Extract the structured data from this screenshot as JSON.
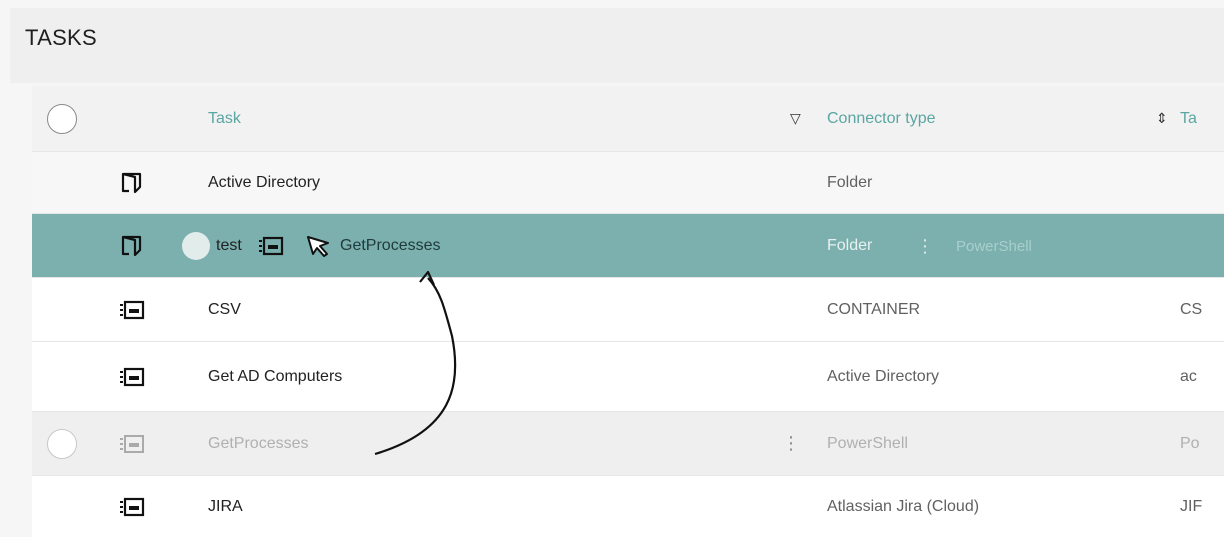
{
  "page": {
    "title": "TASKS"
  },
  "table": {
    "columns": {
      "task": "Task",
      "connector_type": "Connector type",
      "target": "Ta"
    },
    "rows": [
      {
        "task": "Active Directory",
        "connector": "Folder",
        "target": "",
        "icon": "folder-icon"
      },
      {
        "task": "test",
        "connector": "Folder",
        "target": "",
        "icon": "folder-icon"
      },
      {
        "task": "CSV",
        "connector": "CONTAINER",
        "target": "CS",
        "icon": "task-icon"
      },
      {
        "task": "Get AD Computers",
        "connector": "Active Directory",
        "target": "ac",
        "icon": "task-icon"
      },
      {
        "task": "GetProcesses",
        "connector": "PowerShell",
        "target": "Po",
        "icon": "task-icon"
      },
      {
        "task": "JIRA",
        "connector": "Atlassian Jira (Cloud)",
        "target": "JIF",
        "icon": "task-icon"
      }
    ]
  },
  "drag": {
    "label": "GetProcesses",
    "connector": "PowerShell",
    "dots": "⋮"
  },
  "row_menu_dots": "⋮",
  "colors": {
    "accent": "#5aa6a2",
    "selected_row": "#7bb0ae"
  }
}
